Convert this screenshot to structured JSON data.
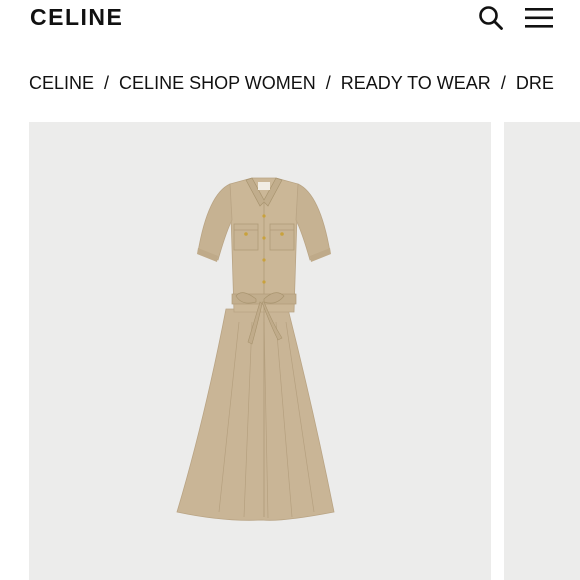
{
  "header": {
    "logo": "CELINE",
    "search_icon": "search-icon",
    "menu_icon": "hamburger-menu-icon"
  },
  "breadcrumb": {
    "items": [
      "CELINE",
      "CELINE SHOP WOMEN",
      "READY TO WEAR",
      "DRE"
    ],
    "separator": "/"
  },
  "product": {
    "image_icon": "shirt-dress-image",
    "dress_color": "#c9b596",
    "background_color": "#ececeb"
  }
}
